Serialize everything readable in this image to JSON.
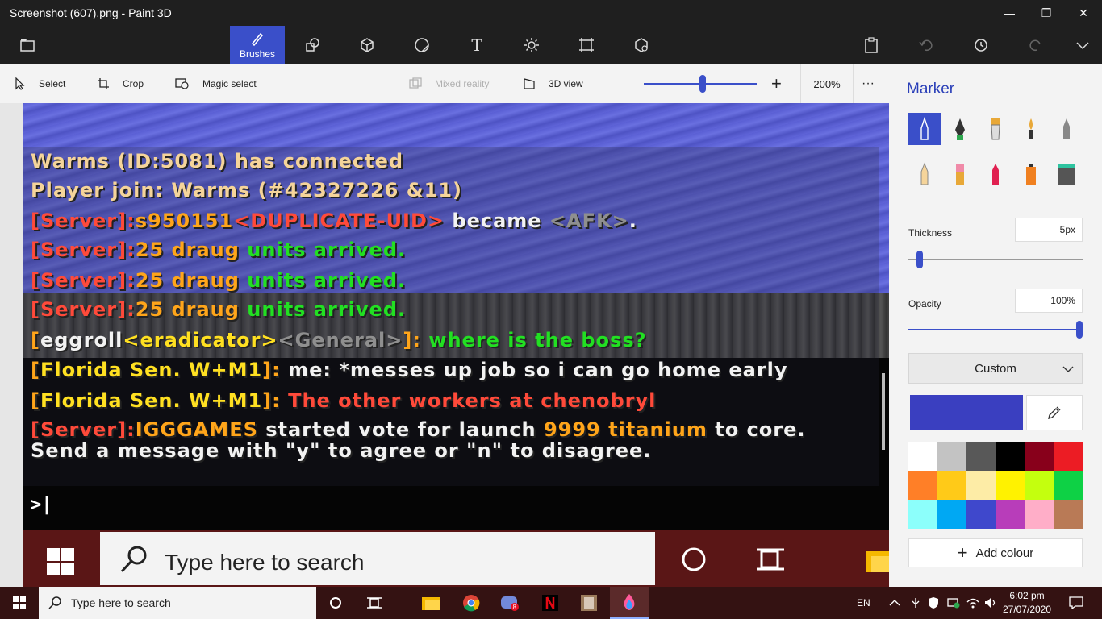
{
  "window": {
    "title": "Screenshot (607).png - Paint 3D",
    "minimize": "—",
    "maximize": "❐",
    "close": "✕"
  },
  "ribbon": {
    "active_label": "Brushes"
  },
  "commandbar": {
    "select": "Select",
    "crop": "Crop",
    "magic_select": "Magic select",
    "mixed_reality": "Mixed reality",
    "view3d": "3D view",
    "zoom_minus": "—",
    "zoom_plus": "+",
    "zoom": "200%",
    "more": "···"
  },
  "chat": {
    "lines": [
      [
        {
          "t": "Warms (ID:5081) has connected",
          "c": "c-peach"
        }
      ],
      [
        {
          "t": "Player join: Warms (#42327226 &11)",
          "c": "c-peach"
        }
      ],
      [
        {
          "t": "[Server]:",
          "c": "c-red"
        },
        {
          "t": "s950151",
          "c": "c-orange"
        },
        {
          "t": "<DUPLICATE-UID>",
          "c": "c-red"
        },
        {
          "t": " became ",
          "c": "c-white"
        },
        {
          "t": "<AFK>",
          "c": "c-grey"
        },
        {
          "t": ".",
          "c": "c-white"
        }
      ],
      [
        {
          "t": "[Server]:",
          "c": "c-red"
        },
        {
          "t": "25 draug ",
          "c": "c-orange"
        },
        {
          "t": "units arrived.",
          "c": "c-green"
        }
      ],
      [
        {
          "t": "[Server]:",
          "c": "c-red"
        },
        {
          "t": "25 draug ",
          "c": "c-orange"
        },
        {
          "t": "units arrived.",
          "c": "c-green"
        }
      ],
      [
        {
          "t": "[Server]:",
          "c": "c-red"
        },
        {
          "t": "25 draug ",
          "c": "c-orange"
        },
        {
          "t": "units arrived.",
          "c": "c-green"
        }
      ],
      [
        {
          "t": "[",
          "c": "c-orange"
        },
        {
          "t": "eggroll",
          "c": "c-white"
        },
        {
          "t": "<eradicator>",
          "c": "c-yellow"
        },
        {
          "t": "<General>",
          "c": "c-grey"
        },
        {
          "t": "]: ",
          "c": "c-orange"
        },
        {
          "t": "where is the boss?",
          "c": "c-green"
        }
      ],
      [
        {
          "t": "[",
          "c": "c-orange"
        },
        {
          "t": "Florida Sen. W+M1",
          "c": "c-yellow"
        },
        {
          "t": "]: ",
          "c": "c-orange"
        },
        {
          "t": "me: *messes up job so i can go home early",
          "c": "c-white"
        }
      ],
      [
        {
          "t": "[",
          "c": "c-orange"
        },
        {
          "t": "Florida Sen. W+M1",
          "c": "c-yellow"
        },
        {
          "t": "]: ",
          "c": "c-orange"
        },
        {
          "t": "The other workers at chenobryl",
          "c": "c-red"
        }
      ],
      [
        {
          "t": "[Server]:",
          "c": "c-red"
        },
        {
          "t": "IGGGAMES",
          "c": "c-orange"
        },
        {
          "t": " started vote for launch ",
          "c": "c-white"
        },
        {
          "t": "9999 titanium",
          "c": "c-orange"
        },
        {
          "t": " to core.",
          "c": "c-white"
        }
      ],
      [
        {
          "t": "Send a message with \"y\" to agree or \"n\" to disagree.",
          "c": "c-white"
        }
      ]
    ],
    "prompt": ">|"
  },
  "inner_taskbar": {
    "search_placeholder": "Type here to search"
  },
  "panel": {
    "title": "Marker",
    "thickness_label": "Thickness",
    "thickness_value": "5px",
    "thickness_level": 0.05,
    "opacity_label": "Opacity",
    "opacity_value": "100%",
    "opacity_level": 1.0,
    "dropdown": "Custom",
    "add_colour": "Add colour",
    "current_color": "#3a3fc0",
    "palette": [
      "#ffffff",
      "#c3c3c3",
      "#585858",
      "#000000",
      "#88001b",
      "#ec1c24",
      "#ff7f27",
      "#ffca18",
      "#fdeca6",
      "#fff200",
      "#c4ff0e",
      "#0ed145",
      "#8cfffb",
      "#00a8f3",
      "#3f48cc",
      "#b83dba",
      "#ffaec8",
      "#b97a56"
    ]
  },
  "taskbar": {
    "search": "Type here to search",
    "lang": "EN",
    "time": "6:02 pm",
    "date": "27/07/2020"
  }
}
